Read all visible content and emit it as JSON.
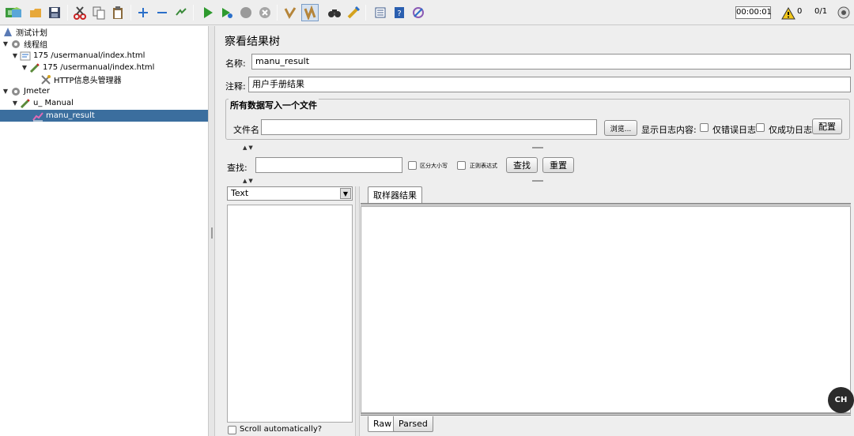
{
  "toolbar": {
    "timer": "00:00:01",
    "warnings": "0",
    "threads": "0/1"
  },
  "tree": {
    "items": [
      {
        "label": "测试计划",
        "level": 0
      },
      {
        "label": "线程组",
        "level": 0
      },
      {
        "label": "175 /usermanual/index.html",
        "level": 1
      },
      {
        "label": "175 /usermanual/index.html",
        "level": 2
      },
      {
        "label": "HTTP信息头管理器",
        "level": 3
      },
      {
        "label": "Jmeter",
        "level": 0
      },
      {
        "label": "u_ Manual",
        "level": 1
      },
      {
        "label": "manu_result",
        "level": 2
      }
    ]
  },
  "main": {
    "title": "察看结果树",
    "name_label": "名称:",
    "name_value": "manu_result",
    "comment_label": "注释:",
    "comment_value": "用户手册结果",
    "file_group_title": "所有数据写入一个文件",
    "filename_label": "文件名",
    "browse_label": "浏览...",
    "log_content_label": "显示日志内容:",
    "errors_only_label": "仅错误日志",
    "success_only_label": "仅成功日志",
    "configure_label": "配置",
    "search_label": "查找:",
    "case_sensitive_label": "区分大小写",
    "regex_label": "正则表达式",
    "find_label": "查找",
    "reset_label": "重置",
    "renderer_selected": "Text",
    "sampler_result_tab": "取样器结果",
    "raw_tab": "Raw",
    "parsed_tab": "Parsed",
    "scroll_auto_label": "Scroll automatically?"
  },
  "badge": "CH"
}
